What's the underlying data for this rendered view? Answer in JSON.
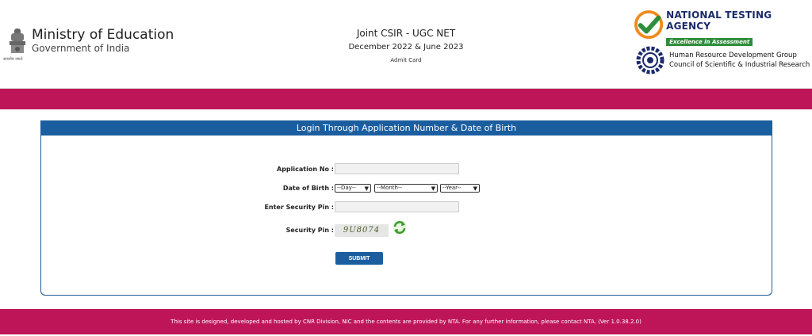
{
  "header": {
    "ministry_title": "Ministry of Education",
    "ministry_sub": "Government of India",
    "emblem_caption": "सत्यमेव जयते",
    "exam_title": "Joint CSIR - UGC NET",
    "session": "December 2022 & June 2023",
    "document": "Admit Card",
    "nta_title": "NATIONAL TESTING AGENCY",
    "nta_tagline": "Excellence in Assessment",
    "csir_line1": "Human Resource Development Group",
    "csir_line2": "Council of Scientific & Industrial Research"
  },
  "form": {
    "title": "Login Through Application Number & Date of Birth",
    "application_label": "Application No :",
    "application_value": "",
    "dob_label": "Date of Birth :",
    "day_selected": "--Day--",
    "month_selected": "--Month--",
    "year_selected": "--Year--",
    "security_pin_label": "Enter Security Pin :",
    "security_pin_value": "",
    "captcha_label": "Security Pin :",
    "captcha_text": "9U8074",
    "submit_label": "SUBMIT"
  },
  "footer": {
    "text": "This site is designed, developed and hosted by CNR Division, NIC and the contents are provided by NTA. For any further information, please contact NTA. (Ver 1.0.38.2.0)"
  },
  "colors": {
    "band": "#be1559",
    "panel_header": "#1b5ea0",
    "nta_green": "#2f8d3c",
    "nta_navy": "#1b2a6b"
  }
}
